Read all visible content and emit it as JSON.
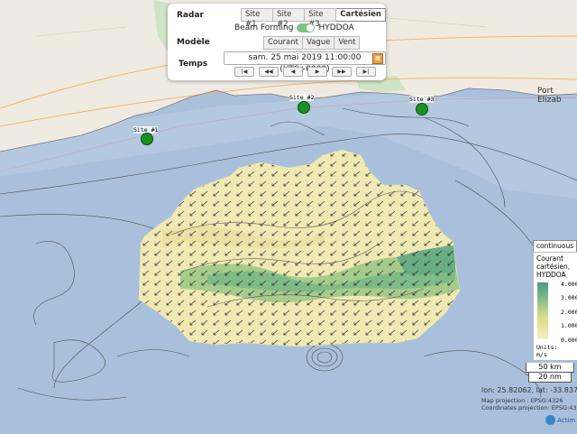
{
  "controls": {
    "radar_label": "Radar",
    "radar_buttons": [
      {
        "label": "Site #1",
        "active": false
      },
      {
        "label": "Site #2",
        "active": false
      },
      {
        "label": "Site #3",
        "active": false
      },
      {
        "label": "Cartésien",
        "active": true
      }
    ],
    "beam_forming_label": "Beam Forming",
    "hyddoa_label": "HYDDOA",
    "modele_label": "Modèle",
    "modele_buttons": [
      {
        "label": "Courant"
      },
      {
        "label": "Vague"
      },
      {
        "label": "Vent"
      }
    ],
    "temps_label": "Temps",
    "datetime": "sam. 25 mai 2019 11:00:00 (UTC+0000)",
    "nav_symbols": [
      "|◀",
      "◀◀",
      "◀",
      "▶",
      "▶▶",
      "▶|"
    ]
  },
  "map": {
    "city_label": "Port Elizab",
    "sites": [
      {
        "label": "Site #1"
      },
      {
        "label": "Site #2"
      },
      {
        "label": "Site #3"
      }
    ]
  },
  "legend": {
    "tab_label": "continuous",
    "title_lines": [
      "Courant",
      "cartésien,",
      "HYDDOA"
    ],
    "ticks": [
      "4.000",
      "3.000",
      "2.000",
      "1.000",
      "0.000"
    ],
    "units_lines": [
      "Units:",
      "m/s"
    ]
  },
  "scale": {
    "km": "50 km",
    "nm": "20 nm"
  },
  "coords": {
    "lonlat": "lon: 25.82062, lat: -33.83789",
    "map_projection": "Map projection : EPSG:4326",
    "coords_projection": "Coordinates projection: EPSG:43"
  },
  "logo": {
    "text": "Actim"
  },
  "colors": {
    "land": "#efebe3",
    "sea": "#a9c0dc",
    "site_marker": "#17931f",
    "toggle_on": "#7dc383"
  }
}
